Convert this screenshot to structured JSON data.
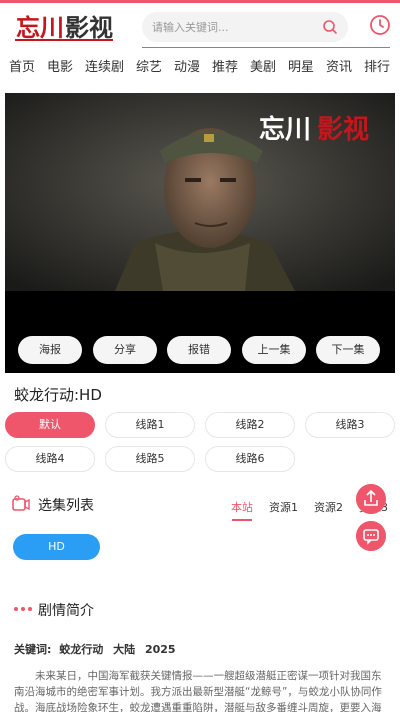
{
  "brand": {
    "logo_text": "忘川影视",
    "accent_color": "#f0566b"
  },
  "search": {
    "placeholder": "请输入关键词..."
  },
  "header_icons": [
    "search-icon",
    "history-clock-icon"
  ],
  "nav": {
    "items": [
      "首页",
      "电影",
      "连续剧",
      "综艺",
      "动漫",
      "推荐",
      "美剧",
      "明星",
      "资讯",
      "排行"
    ]
  },
  "player": {
    "watermark": "忘川影视",
    "controls": [
      "海报",
      "分享",
      "报错",
      "上一集",
      "下一集"
    ]
  },
  "video": {
    "title": "蛟龙行动:HD"
  },
  "routes": {
    "items": [
      "默认",
      "线路1",
      "线路2",
      "线路3",
      "线路4",
      "线路5",
      "线路6"
    ],
    "selected": "默认"
  },
  "episodes": {
    "section_title": "选集列表",
    "sources": [
      "本站",
      "资源1",
      "资源2",
      "资源3"
    ],
    "active_source": "本站",
    "items": [
      "HD"
    ]
  },
  "fab": {
    "share_icon": "share-icon",
    "message_icon": "message-icon"
  },
  "intro": {
    "section_title": "剧情简介",
    "keywords_label": "关键词:",
    "keywords": [
      "蛟龙行动",
      "大陆",
      "2025"
    ],
    "summary": "未来某日，中国海军截获关键情报——一艘超级潜艇正密谋一项针对我国东南沿海城市的绝密军事计划。我方派出最新型潜艇“龙鲸号”，与蛟龙小队协同作战。海底战场险象环生，蛟龙遭遇重重陷阱，潜艇与敌多番缠斗周旋，更要入海"
  }
}
